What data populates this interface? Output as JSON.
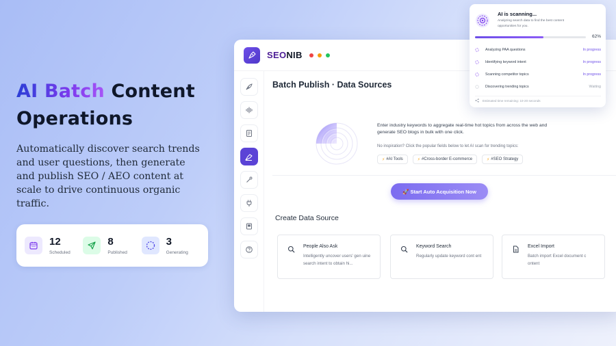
{
  "hero": {
    "title_grad": "AI Batch",
    "title_rest": " Content",
    "title_line2": "Operations",
    "description": "Automatically discover search trends and user questions, then generate and publish SEO / AEO content at scale to drive continuous organic traffic."
  },
  "stats": [
    {
      "value": "12",
      "label": "Scheduled",
      "icon": "calendar-icon"
    },
    {
      "value": "8",
      "label": "Published",
      "icon": "send-icon"
    },
    {
      "value": "3",
      "label": "Generating",
      "icon": "loading-icon"
    }
  ],
  "app": {
    "logo_a": "SEO",
    "logo_b": "NIB",
    "window_dots": [
      "#ef4444",
      "#f59e0b",
      "#22c55e"
    ],
    "accent": "#5b43d6"
  },
  "sidebar": {
    "icons": [
      "feather-icon",
      "waveform-icon",
      "document-icon",
      "publish-icon",
      "magic-wand-icon",
      "plug-icon",
      "book-icon",
      "help-icon"
    ],
    "active_index": 3
  },
  "main": {
    "title": "Batch Publish · Data Sources",
    "intro": "Enter industry keywords to aggregate real-time hot topics from across the web and generate SEO blogs in bulk with one click.",
    "hint": "No inspiration? Click the popular fields below to let AI scan for trending topics:",
    "chips": [
      "#AI Tools",
      "#Cross-border E-commerce",
      "#SEO Strategy"
    ],
    "cta": "🚀 Start Auto Acquisition Now",
    "section_title": "Create Data Source",
    "cards": [
      {
        "title": "People Also Ask",
        "desc": "Intelligently uncover users' gen uine search intent to obtain hi..."
      },
      {
        "title": "Keyword Search",
        "desc": "Regularly update keyword cont ent"
      },
      {
        "title": "Excel Import",
        "desc": "Batch import Excel document c ontent"
      }
    ]
  },
  "scan": {
    "title": "AI is scanning...",
    "subtitle": "Analyzing search data to find the best content opportunities for you.",
    "progress_percent": 62,
    "progress_label": "62%",
    "tasks": [
      {
        "name": "Analyzing PAA questions",
        "status": "In progress"
      },
      {
        "name": "Identifying keyword intent",
        "status": "In progress"
      },
      {
        "name": "Scanning competitor topics",
        "status": "In progress"
      },
      {
        "name": "Discovering trending topics",
        "status": "Waiting"
      }
    ],
    "eta": "Estimated time remaining: 10-20 seconds"
  }
}
